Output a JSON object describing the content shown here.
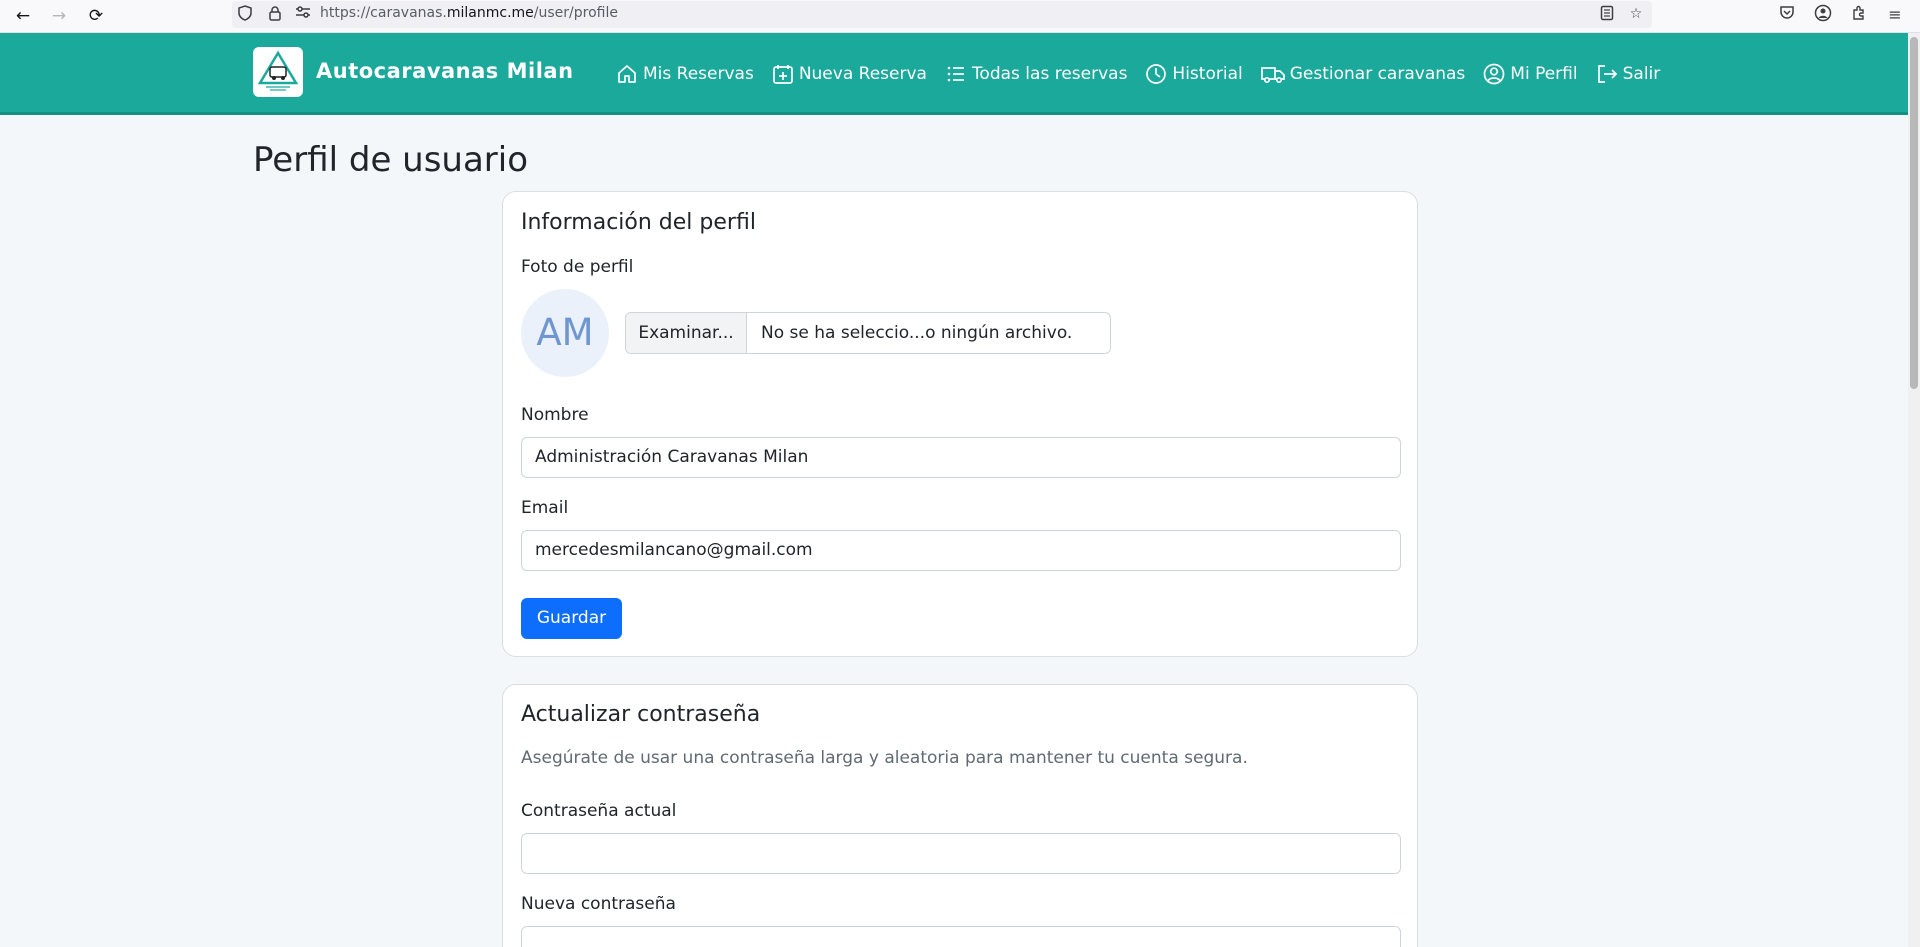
{
  "browser": {
    "url_prefix": "https://caravanas.",
    "url_host": "milanmc.me",
    "url_path": "/user/profile"
  },
  "navbar": {
    "brand": "Autocaravanas Milan",
    "links": [
      {
        "label": "Mis Reservas",
        "icon": "house-icon"
      },
      {
        "label": "Nueva Reserva",
        "icon": "calendar-plus-icon"
      },
      {
        "label": "Todas las reservas",
        "icon": "list-icon"
      },
      {
        "label": "Historial",
        "icon": "clock-icon"
      },
      {
        "label": "Gestionar caravanas",
        "icon": "truck-icon"
      },
      {
        "label": "Mi Perfil",
        "icon": "person-circle-icon"
      },
      {
        "label": "Salir",
        "icon": "logout-icon"
      }
    ],
    "color": "#1aa99b"
  },
  "page": {
    "title": "Perfil de usuario"
  },
  "profile_card": {
    "title": "Información del perfil",
    "photo_label": "Foto de perfil",
    "avatar_initials": "AM",
    "file_button": "Examinar...",
    "file_status": "No se ha seleccio...o ningún archivo.",
    "name_label": "Nombre",
    "name_value": "Administración Caravanas Milan",
    "email_label": "Email",
    "email_value": "mercedesmilancano@gmail.com",
    "save_label": "Guardar"
  },
  "password_card": {
    "title": "Actualizar contraseña",
    "description": "Asegúrate de usar una contraseña larga y aleatoria para mantener tu cuenta segura.",
    "current_label": "Contraseña actual",
    "current_value": "",
    "new_label": "Nueva contraseña",
    "new_value": ""
  },
  "colors": {
    "primary": "#0d6efd",
    "accent": "#1aa99b"
  }
}
